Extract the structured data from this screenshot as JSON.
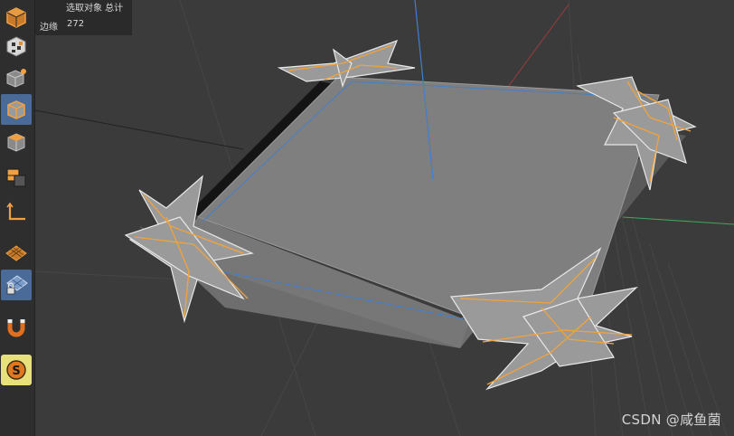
{
  "hud": {
    "header": "选取对象 总计",
    "edges_label": "边缘",
    "edges_value": "272"
  },
  "toolbar": {
    "items": [
      {
        "icon": "object-mode-icon",
        "active": false
      },
      {
        "icon": "texture-mode-icon",
        "active": false
      },
      {
        "icon": "point-mode-icon",
        "active": false
      },
      {
        "icon": "edge-mode-icon",
        "active": true
      },
      {
        "icon": "polygon-mode-icon",
        "active": false
      },
      {
        "icon": "uv-mode-icon",
        "active": false
      },
      {
        "icon": "axis-mode-icon",
        "active": false
      },
      {
        "icon": "workplane-icon",
        "active": false
      },
      {
        "icon": "locked-workplane-icon",
        "active": true
      },
      {
        "icon": "magnet-icon",
        "active": false
      },
      {
        "icon": "snap-icon",
        "active": false
      }
    ]
  },
  "colors": {
    "accent_active": "#4a6a98",
    "selection_orange": "#f2a33a",
    "axis_y": "#3f7fd0",
    "axis_x": "#c84a4a",
    "axis_z": "#3fa85a"
  },
  "watermark": "CSDN @咸鱼菌"
}
